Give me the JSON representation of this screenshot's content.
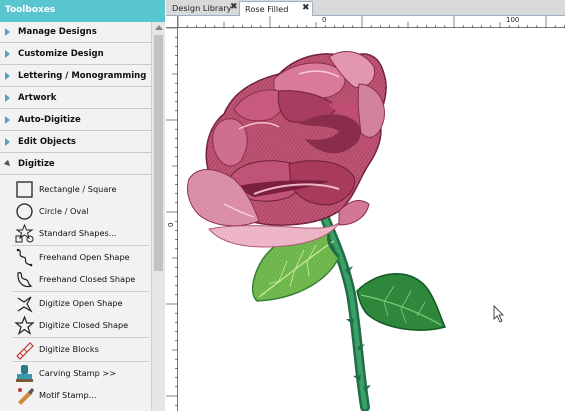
{
  "toolboxes": {
    "title": "Toolboxes",
    "categories": [
      {
        "label": "Manage Designs",
        "expanded": false
      },
      {
        "label": "Customize Design",
        "expanded": false
      },
      {
        "label": "Lettering / Monogramming",
        "expanded": false
      },
      {
        "label": "Artwork",
        "expanded": false
      },
      {
        "label": "Auto-Digitize",
        "expanded": false
      },
      {
        "label": "Edit Objects",
        "expanded": false
      },
      {
        "label": "Digitize",
        "expanded": true
      }
    ],
    "tools": [
      {
        "label": "Rectangle / Square",
        "icon": "rectangle-icon"
      },
      {
        "label": "Circle / Oval",
        "icon": "circle-icon"
      },
      {
        "label": "Standard Shapes...",
        "icon": "shapes-icon"
      },
      {
        "label": "Freehand Open Shape",
        "icon": "freehand-open-icon"
      },
      {
        "label": "Freehand Closed Shape",
        "icon": "freehand-closed-icon"
      },
      {
        "label": "Digitize Open Shape",
        "icon": "digitize-open-icon"
      },
      {
        "label": "Digitize Closed Shape",
        "icon": "digitize-closed-icon"
      },
      {
        "label": "Digitize Blocks",
        "icon": "digitize-blocks-icon"
      },
      {
        "label": "Carving Stamp >>",
        "icon": "carving-stamp-icon"
      },
      {
        "label": "Motif Stamp...",
        "icon": "motif-stamp-icon"
      }
    ]
  },
  "tabs": [
    {
      "label": "Design Library",
      "close": "✖",
      "active": false
    },
    {
      "label": "Rose Filled",
      "close": "✖",
      "active": true
    }
  ],
  "rulers": {
    "horizontal_labels": [
      "0",
      "100"
    ],
    "vertical_labels": [
      "0"
    ]
  },
  "colors": {
    "header": "#58c5cf",
    "rose_dark": "#9e3a55",
    "rose_light": "#e8a0b4",
    "stem": "#2e8b57",
    "leaf_light": "#7cc24e",
    "leaf_dark": "#2e7d32"
  }
}
